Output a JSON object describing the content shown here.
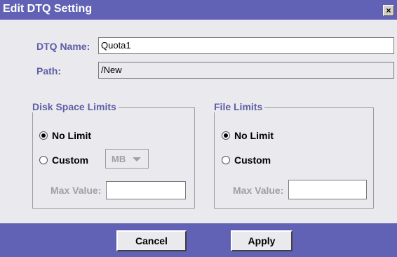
{
  "window": {
    "title": "Edit DTQ Setting",
    "close_glyph": "×"
  },
  "form": {
    "dtq_name_label": "DTQ Name:",
    "dtq_name_value": "Quota1",
    "path_label": "Path:",
    "path_value": "/New"
  },
  "disk_space_limits": {
    "legend": "Disk Space Limits",
    "no_limit_label": "No Limit",
    "custom_label": "Custom",
    "unit_selected": "MB",
    "max_value_label": "Max Value:",
    "max_value": "",
    "selected": "no_limit"
  },
  "file_limits": {
    "legend": "File Limits",
    "no_limit_label": "No Limit",
    "custom_label": "Custom",
    "max_value_label": "Max Value:",
    "max_value": "",
    "selected": "no_limit"
  },
  "buttons": {
    "cancel": "Cancel",
    "apply": "Apply"
  },
  "colors": {
    "title_bar": "#6161b5",
    "footer": "#6161b5",
    "label": "#5e5ea6",
    "background": "#e9e9ee"
  }
}
